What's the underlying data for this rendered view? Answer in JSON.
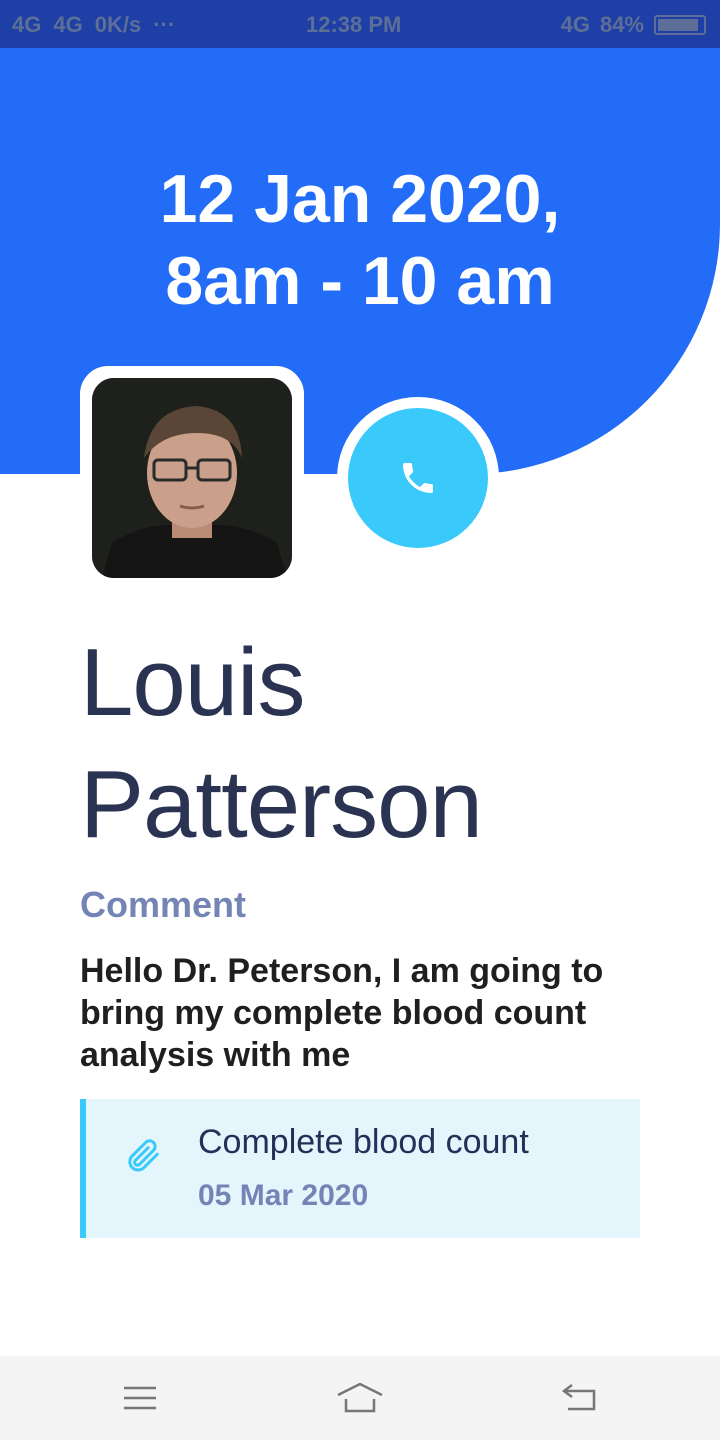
{
  "status_bar": {
    "left": [
      "4G",
      "4G",
      "0K/s",
      "···"
    ],
    "time": "12:38 PM",
    "right": [
      "4G",
      "84%"
    ]
  },
  "appointment": {
    "date_line": "12 Jan 2020,",
    "time_line": "8am - 10 am"
  },
  "patient": {
    "first_name": "Louis",
    "last_name": "Patterson"
  },
  "comment": {
    "label": "Comment",
    "text": "Hello Dr. Peterson, I am going to bring my complete blood count analysis with me"
  },
  "attachment": {
    "title": "Complete blood count",
    "date": "05 Mar 2020"
  },
  "colors": {
    "header": "#226cf8",
    "call_button": "#3ac9fb",
    "attachment_bg": "#e4f6fc"
  }
}
